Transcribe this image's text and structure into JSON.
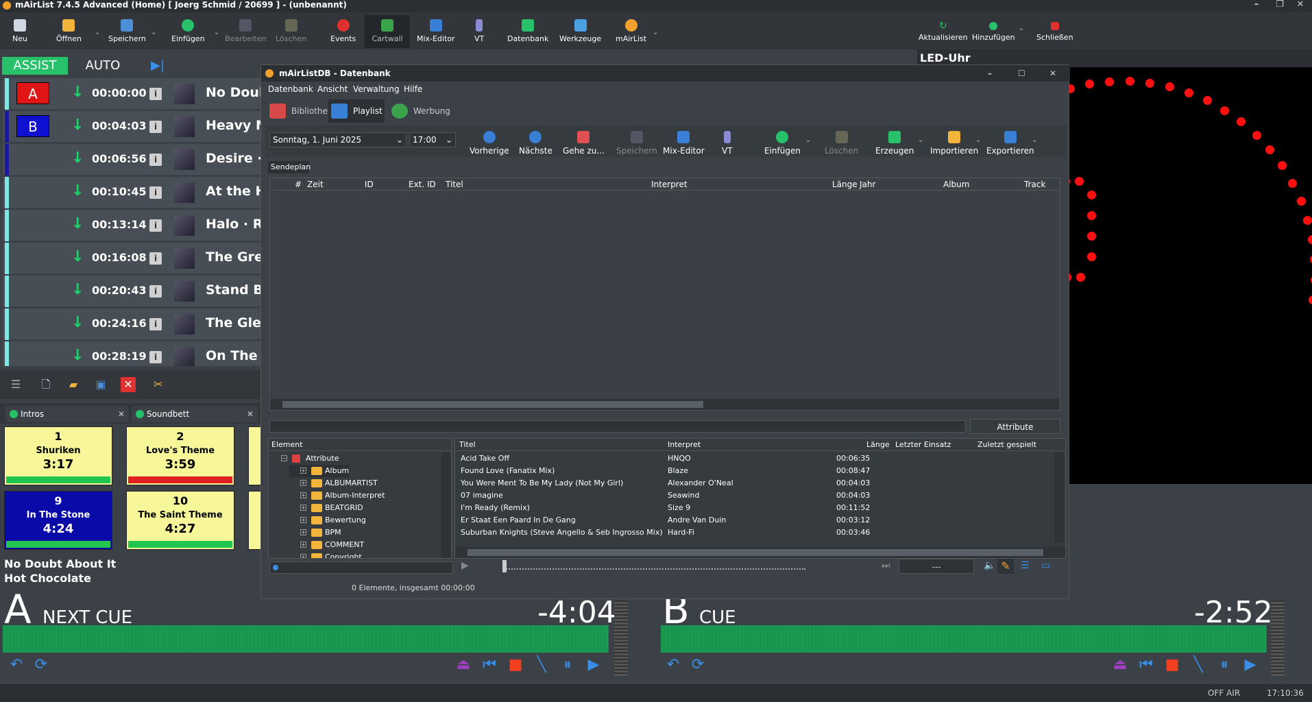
{
  "app": {
    "title": "mAirList 7.4.5 Advanced (Home) [ Joerg Schmid / 20699 ] - (unbenannt)"
  },
  "toolbar": {
    "items": [
      {
        "label": "Neu",
        "icon": "new-file-icon"
      },
      {
        "label": "Öffnen",
        "icon": "folder-open-icon"
      },
      {
        "label": "Speichern",
        "icon": "save-icon"
      },
      {
        "label": "Einfügen",
        "icon": "plus-circle-icon"
      },
      {
        "label": "Bearbeiten",
        "icon": "edit-icon"
      },
      {
        "label": "Löschen",
        "icon": "delete-icon"
      },
      {
        "label": "Events",
        "icon": "clock-icon"
      },
      {
        "label": "Cartwall",
        "icon": "cartwall-icon"
      },
      {
        "label": "Mix-Editor",
        "icon": "waveform-icon"
      },
      {
        "label": "VT",
        "icon": "microphone-icon"
      },
      {
        "label": "Datenbank",
        "icon": "database-icon"
      },
      {
        "label": "Werkzeuge",
        "icon": "tools-icon"
      },
      {
        "label": "mAirList",
        "icon": "mairlist-logo-icon"
      }
    ],
    "right_items": [
      {
        "label": "Aktualisieren",
        "icon": "refresh-icon"
      },
      {
        "label": "Hinzufügen",
        "icon": "add-icon"
      },
      {
        "label": "Schließen",
        "icon": "close-red-icon"
      }
    ]
  },
  "mode": {
    "assist": "ASSIST",
    "auto": "AUTO",
    "skip": "▶|"
  },
  "playlist": [
    {
      "marker": "A",
      "marker_color": "#e01515",
      "time": "00:00:00",
      "title": "No Doubt",
      "stripe": "light"
    },
    {
      "marker": "B",
      "marker_color": "#1010d0",
      "time": "00:04:03",
      "title": "Heavy M",
      "stripe": "dark"
    },
    {
      "marker": "",
      "marker_color": "",
      "time": "00:06:56",
      "title": "Desire · I",
      "stripe": "dark"
    },
    {
      "marker": "",
      "marker_color": "",
      "time": "00:10:45",
      "title": "At the Ho",
      "stripe": "light"
    },
    {
      "marker": "",
      "marker_color": "",
      "time": "00:13:14",
      "title": "Halo · Re",
      "stripe": "light"
    },
    {
      "marker": "",
      "marker_color": "",
      "time": "00:16:08",
      "title": "The Grea",
      "stripe": "light"
    },
    {
      "marker": "",
      "marker_color": "",
      "time": "00:20:43",
      "title": "Stand By",
      "stripe": "light"
    },
    {
      "marker": "",
      "marker_color": "",
      "time": "00:24:16",
      "title": "The Glen",
      "stripe": "light"
    },
    {
      "marker": "",
      "marker_color": "",
      "time": "00:28:19",
      "title": "On The D",
      "stripe": "light"
    }
  ],
  "cart_tabs": [
    {
      "label": "Intros"
    },
    {
      "label": "Soundbett"
    }
  ],
  "carts": [
    {
      "num": "1",
      "name": "Shuriken",
      "len": "3:17",
      "bg": "#f7f79a",
      "bar": "#22c64f"
    },
    {
      "num": "2",
      "name": "Love's Theme",
      "len": "3:59",
      "bg": "#f7f79a",
      "bar": "#e02020"
    },
    {
      "num": "9",
      "name": "In The Stone",
      "len": "4:24",
      "bg": "#0a0aa8",
      "bar": "#22c64f"
    },
    {
      "num": "10",
      "name": "The Saint Theme",
      "len": "4:27",
      "bg": "#f7f79a",
      "bar": "#22c64f"
    }
  ],
  "now_playing": {
    "title": "No Doubt About It",
    "artist": "Hot Chocolate"
  },
  "player_a": {
    "letter": "A",
    "cue": "NEXT CUE",
    "remaining": "-4:04"
  },
  "player_b": {
    "letter": "B",
    "cue": "CUE",
    "remaining": "-2:52"
  },
  "led": {
    "title": "LED-Uhr"
  },
  "db": {
    "title": "mAirListDB - Datenbank",
    "menu": [
      "Datenbank",
      "Ansicht",
      "Verwaltung",
      "Hilfe"
    ],
    "tabs": [
      {
        "label": "Bibliothek"
      },
      {
        "label": "Playlist"
      },
      {
        "label": "Werbung"
      }
    ],
    "date": "Sonntag, 1. Juni 2025",
    "hour": "17:00",
    "buttons": [
      "Vorherige",
      "Nächste",
      "Gehe zu...",
      "Speichern",
      "Mix-Editor",
      "VT",
      "Einfügen",
      "Löschen",
      "Erzeugen",
      "Importieren",
      "Exportieren"
    ],
    "subtab": "Sendeplan",
    "columns": [
      "#",
      "Zeit",
      "ID",
      "Ext. ID",
      "Titel",
      "Interpret",
      "Länge",
      "Jahr",
      "Album",
      "Track"
    ],
    "attr_button": "Attribute bearbeiten...",
    "tree_header": "Element",
    "tree": [
      "Attribute",
      "Album",
      "ALBUMARTIST",
      "Album-Interpret",
      "BEATGRID",
      "Bewertung",
      "BPM",
      "COMMENT",
      "Copyright"
    ],
    "list_columns": [
      "Titel",
      "Interpret",
      "Länge",
      "Letzter Einsatz",
      "Zuletzt gespielt"
    ],
    "list_rows": [
      {
        "title": "Acid Take Off",
        "artist": "HNQO",
        "len": "00:06:35"
      },
      {
        "title": "Found Love (Fanatix Mix)",
        "artist": "Blaze",
        "len": "00:08:47"
      },
      {
        "title": "You Were Ment To Be My Lady (Not My Girl)",
        "artist": "Alexander O'Neal",
        "len": "00:04:03"
      },
      {
        "title": "07 imagine",
        "artist": "Seawind",
        "len": "00:04:03"
      },
      {
        "title": "I'm Ready (Remix)",
        "artist": "Size 9",
        "len": "00:11:52"
      },
      {
        "title": "Er Staat Een Paard In De Gang",
        "artist": "Andre Van Duin",
        "len": "00:03:12"
      },
      {
        "title": "Suburban Knights (Steve Angello & Seb Ingrosso Mix)",
        "artist": "Hard-Fi",
        "len": "00:03:46"
      }
    ],
    "player_time": "---",
    "status": "0 Elemente, insgesamt 00:00:00"
  },
  "status": {
    "onair": "OFF AIR",
    "clock": "17:10:36"
  }
}
